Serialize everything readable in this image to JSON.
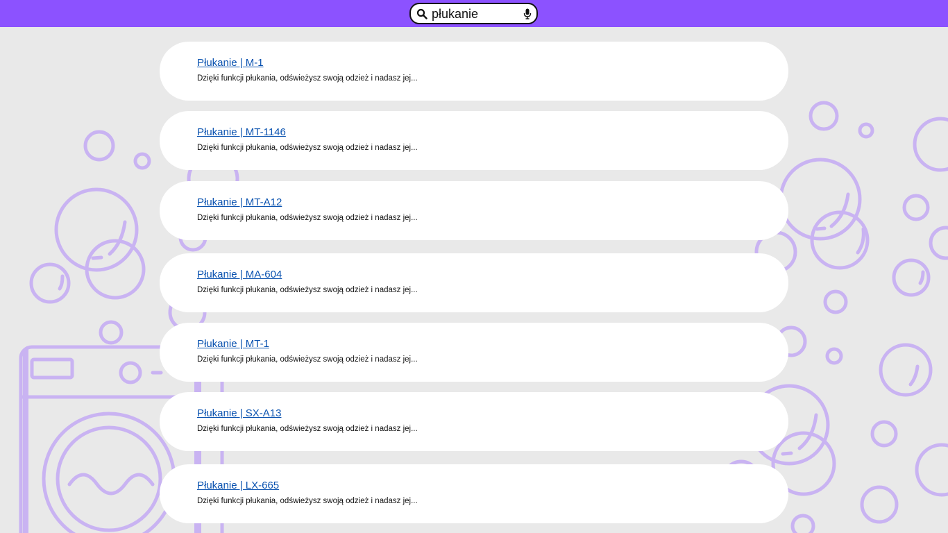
{
  "search": {
    "value": "płukanie",
    "icon": "search-icon",
    "mic_icon": "microphone-icon"
  },
  "colors": {
    "topbar": "#8c52ff",
    "background": "#e9e9e9",
    "decoration": "#c9b3f2",
    "link": "#0b53b0"
  },
  "results": [
    {
      "title": "Płukanie | M-1",
      "snippet": "Dzięki funkcji płukania, odświeżysz swoją odzież i nadasz jej..."
    },
    {
      "title": "Płukanie | MT-1146",
      "snippet": "Dzięki funkcji płukania, odświeżysz swoją odzież i nadasz jej..."
    },
    {
      "title": "Płukanie | MT-A12",
      "snippet": "Dzięki funkcji płukania, odświeżysz swoją odzież i nadasz jej..."
    },
    {
      "title": "Płukanie | MA-604",
      "snippet": "Dzięki funkcji płukania, odświeżysz swoją odzież i nadasz jej..."
    },
    {
      "title": "Płukanie | MT-1",
      "snippet": "Dzięki funkcji płukania, odświeżysz swoją odzież i nadasz jej..."
    },
    {
      "title": "Płukanie | SX-A13",
      "snippet": "Dzięki funkcji płukania, odświeżysz swoją odzież i nadasz jej..."
    },
    {
      "title": "Płukanie | LX-665",
      "snippet": "Dzięki funkcji płukania, odświeżysz swoją odzież i nadasz jej..."
    }
  ]
}
